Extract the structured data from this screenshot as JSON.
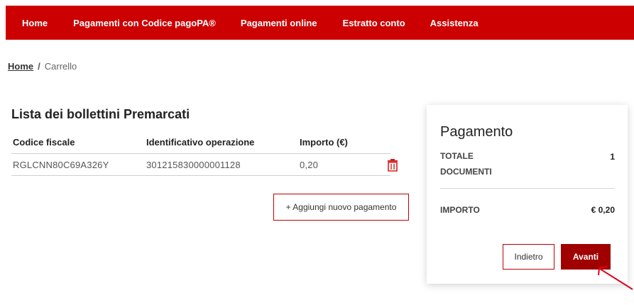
{
  "nav": {
    "items": [
      "Home",
      "Pagamenti con Codice pagoPA®",
      "Pagamenti online",
      "Estratto conto",
      "Assistenza"
    ],
    "bar_color": "#cc0000"
  },
  "breadcrumb": {
    "home": "Home",
    "separator": "/",
    "current": "Carrello"
  },
  "list": {
    "title": "Lista dei bollettini Premarcati",
    "columns": [
      "Codice fiscale",
      "Identificativo operazione",
      "Importo (€)"
    ],
    "rows": [
      {
        "codice_fiscale": "RGLCNN80C69A326Y",
        "identificativo": "301215830000001128",
        "importo": "0,20",
        "action_icon": "trash-icon"
      }
    ],
    "add_button": "+ Aggiungi nuovo pagamento"
  },
  "payment": {
    "title": "Pagamento",
    "totale_label": "TOTALE DOCUMENTI",
    "totale_value": "1",
    "importo_label": "IMPORTO",
    "importo_value": "€ 0,20",
    "back_button": "Indietro",
    "next_button": "Avanti"
  },
  "colors": {
    "accent": "#cc0000",
    "button_primary": "#a00000",
    "annotation_arrow": "#e0001b"
  }
}
